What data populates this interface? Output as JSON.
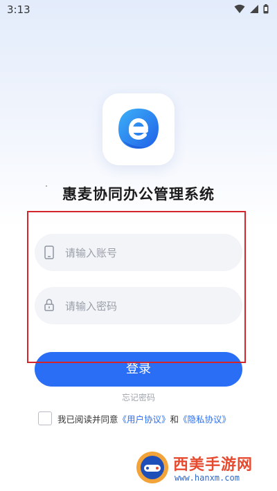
{
  "status_bar": {
    "time": "3:13",
    "icons": [
      "wifi-icon",
      "signal-icon",
      "battery-icon"
    ]
  },
  "app": {
    "title": "惠麦协同办公管理系统",
    "logo_icon": "app-logo-e-icon"
  },
  "login_form": {
    "account_placeholder": "请输入账号",
    "account_value": "",
    "account_icon": "phone-icon",
    "password_placeholder": "请输入密码",
    "password_value": "",
    "password_icon": "lock-icon",
    "login_label": "登录",
    "forgot_label": "忘记密码"
  },
  "agreement": {
    "checked": false,
    "prefix": "我已阅读并同意",
    "user_agreement": "《用户协议》",
    "conjunction": "和",
    "privacy_agreement": "《隐私协议》"
  },
  "watermark": {
    "text": "西美手游网",
    "url": "www.hanxm.com"
  },
  "colors": {
    "accent": "#2a6ef5",
    "highlight": "#d6242b"
  }
}
